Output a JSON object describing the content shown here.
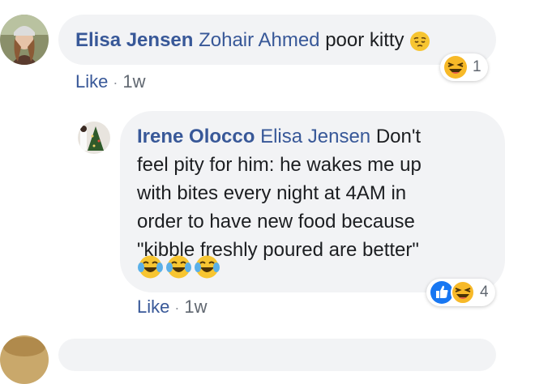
{
  "comments": [
    {
      "author": "Elisa Jensen",
      "mention": "Zohair Ahmed",
      "text": "poor kitty",
      "actions": {
        "like_label": "Like",
        "time": "1w"
      },
      "reactions": {
        "count": "1",
        "icons": [
          "laughing-react-icon"
        ]
      }
    },
    {
      "author": "Irene Olocco",
      "mention": "Elisa Jensen",
      "text_line1": "Don't",
      "text_line2": "feel pity for him: he wakes me up",
      "text_line3": "with bites every night at 4AM in",
      "text_line4": "order to have new food because",
      "text_line5": "\"kibble freshly poured are better\"",
      "actions": {
        "like_label": "Like",
        "time": "1w"
      },
      "reactions": {
        "count": "4",
        "icons": [
          "like-react-icon",
          "laughing-react-icon"
        ]
      }
    }
  ],
  "colors": {
    "link": "#385898",
    "bubble": "#f2f3f5",
    "meta": "#606770"
  }
}
